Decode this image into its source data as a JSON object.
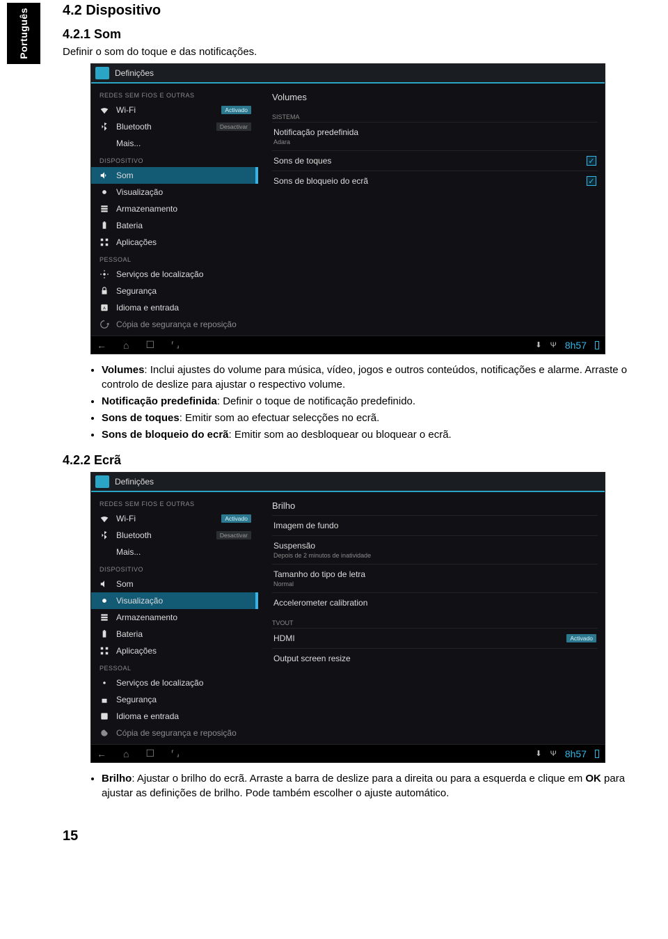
{
  "sidetab": "Português",
  "sec1_title": "4.2  Dispositivo",
  "sec1_sub": "4.2.1  Som",
  "sec1_lead": "Definir o som do toque e das notificações.",
  "shot_title": "Definições",
  "left": {
    "cat_redes": "REDES SEM FIOS E OUTRAS",
    "wifi": "Wi-Fi",
    "wifi_state": "Activado",
    "bt": "Bluetooth",
    "bt_state": "Desactivar",
    "mais": "Mais...",
    "cat_disp": "DISPOSITIVO",
    "som": "Som",
    "vis": "Visualização",
    "arm": "Armazenamento",
    "bat": "Bateria",
    "app": "Aplicações",
    "cat_pes": "PESSOAL",
    "serv": "Serviços de localização",
    "seg": "Segurança",
    "idi": "Idioma e entrada",
    "cop": "Cópia de segurança e reposição"
  },
  "r1": {
    "head": "Volumes",
    "cat": "SISTEMA",
    "notif": "Notificação predefinida",
    "notif_sub": "Adara",
    "toques": "Sons de toques",
    "bloq": "Sons de bloqueio do ecrã"
  },
  "clock": "8h57",
  "bul1_a": "Volumes",
  "bul1_a_t": ": Inclui ajustes do volume para música, vídeo, jogos e outros conteúdos, notificações e alarme. Arraste o controlo de deslize para ajustar o respectivo volume.",
  "bul1_b": "Notificação predefinida",
  "bul1_b_t": ": Definir o toque de notificação predefinido.",
  "bul1_c": "Sons de toques",
  "bul1_c_t": ": Emitir som ao efectuar selecções no ecrã.",
  "bul1_d": "Sons de bloqueio do ecrã",
  "bul1_d_t": ": Emitir som ao desbloquear ou bloquear o ecrã.",
  "sec2_sub": "4.2.2  Ecrã",
  "r2": {
    "brilho": "Brilho",
    "img": "Imagem de fundo",
    "susp": "Suspensão",
    "susp_sub": "Depois de 2 minutos de inatividade",
    "tam": "Tamanho do tipo de letra",
    "tam_sub": "Normal",
    "acc": "Accelerometer calibration",
    "cat": "TVOUT",
    "hdmi": "HDMI",
    "hdmi_state": "Activado",
    "out": "Output screen resize"
  },
  "bul2_a": "Brilho",
  "bul2_a_t1": ": Ajustar o brilho do ecrã. Arraste a barra de deslize para a direita ou para a esquerda e clique em ",
  "bul2_a_ok": "OK",
  "bul2_a_t2": " para ajustar as definições de brilho. Pode também escolher o ajuste automático.",
  "pagenum": "15"
}
